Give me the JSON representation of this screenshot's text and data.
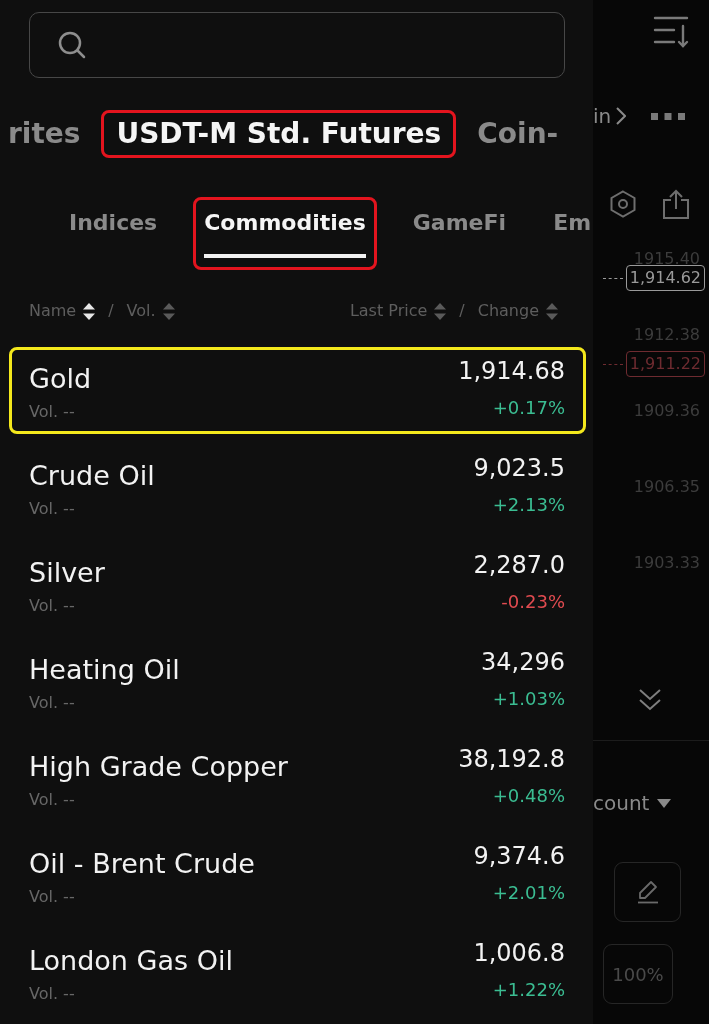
{
  "market_tabs": [
    {
      "label": "rites",
      "selected": false,
      "highlighted": false
    },
    {
      "label": "USDT-M Std. Futures",
      "selected": true,
      "highlighted": true
    },
    {
      "label": "Coin-",
      "selected": false,
      "highlighted": false
    }
  ],
  "category_tabs": [
    {
      "label": "Indices",
      "selected": false,
      "highlighted": false
    },
    {
      "label": "Commodities",
      "selected": true,
      "highlighted": true
    },
    {
      "label": "GameFi",
      "selected": false,
      "highlighted": false
    },
    {
      "label": "Em",
      "selected": false,
      "highlighted": false
    }
  ],
  "list_header": {
    "left": {
      "columns": [
        {
          "label": "Name",
          "sorted": true
        },
        {
          "label": "Vol.",
          "sorted": false
        }
      ],
      "separator": "/"
    },
    "right": {
      "columns": [
        {
          "label": "Last Price",
          "sorted": false
        },
        {
          "label": "Change",
          "sorted": false
        }
      ],
      "separator": "/"
    }
  },
  "rows": [
    {
      "name": "Gold",
      "volume": "Vol. --",
      "last_price": "1,914.68",
      "change": "+0.17%",
      "color": "#3bbd92",
      "highlighted": true
    },
    {
      "name": "Crude Oil",
      "volume": "Vol. --",
      "last_price": "9,023.5",
      "change": "+2.13%",
      "color": "#3bbd92",
      "highlighted": false
    },
    {
      "name": "Silver",
      "volume": "Vol. --",
      "last_price": "2,287.0",
      "change": "-0.23%",
      "color": "#e14b50",
      "highlighted": false
    },
    {
      "name": "Heating Oil",
      "volume": "Vol. --",
      "last_price": "34,296",
      "change": "+1.03%",
      "color": "#3bbd92",
      "highlighted": false
    },
    {
      "name": "High Grade Copper",
      "volume": "Vol. --",
      "last_price": "38,192.8",
      "change": "+0.48%",
      "color": "#3bbd92",
      "highlighted": false
    },
    {
      "name": "Oil - Brent Crude",
      "volume": "Vol. --",
      "last_price": "9,374.6",
      "change": "+2.01%",
      "color": "#3bbd92",
      "highlighted": false
    },
    {
      "name": "London Gas Oil",
      "volume": "Vol. --",
      "last_price": "1,006.8",
      "change": "+1.22%",
      "color": "#3bbd92",
      "highlighted": false
    }
  ],
  "backdrop": {
    "nav_text": "in",
    "price_axis": [
      {
        "text": "1915.40",
        "kind": "tick"
      },
      {
        "text": "1,914.62",
        "kind": "last"
      },
      {
        "text": "1912.38",
        "kind": "tick"
      },
      {
        "text": "1,911.22",
        "kind": "marked"
      },
      {
        "text": "1909.36",
        "kind": "tick"
      },
      {
        "text": "1906.35",
        "kind": "tick"
      },
      {
        "text": "1903.33",
        "kind": "tick"
      }
    ],
    "dropdown_label": "count",
    "percent_button": "100%"
  }
}
